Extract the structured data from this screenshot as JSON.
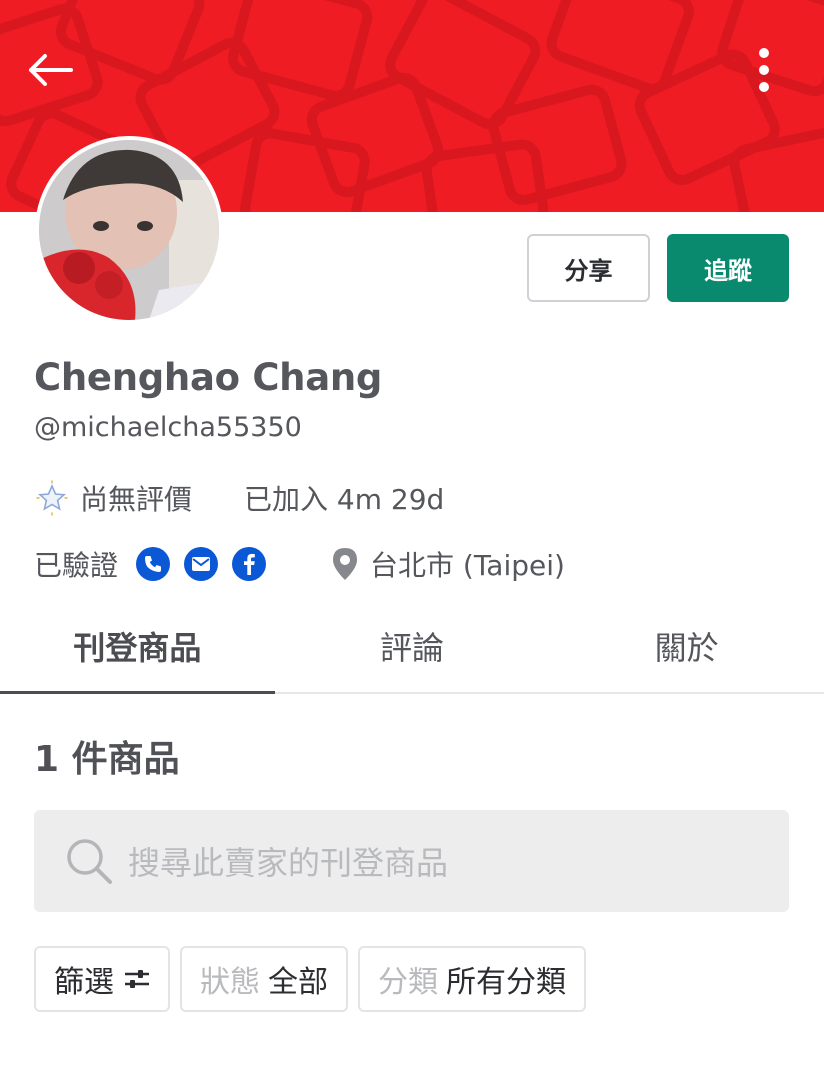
{
  "header": {
    "back_icon": "arrow-left-icon",
    "more_icon": "vertical-dots-icon",
    "banner_color": "#ef1c24"
  },
  "profile": {
    "name": "Chenghao Chang",
    "handle": "@michaelcha55350",
    "rating_text": "尚無評價",
    "joined_text": "已加入 4m 29d",
    "verified_label": "已驗證",
    "verified_icons": [
      "phone-icon",
      "email-icon",
      "facebook-icon"
    ],
    "location": "台北市 (Taipei)"
  },
  "actions": {
    "share_label": "分享",
    "follow_label": "追蹤",
    "follow_color": "#098a6e"
  },
  "tabs": [
    {
      "label": "刊登商品",
      "active": true
    },
    {
      "label": "評論",
      "active": false
    },
    {
      "label": "關於",
      "active": false
    }
  ],
  "listings": {
    "count_text": "1 件商品",
    "search_placeholder": "搜尋此賣家的刊登商品",
    "filters": {
      "filter_label": "篩選",
      "status_label": "狀態",
      "status_value": "全部",
      "category_label": "分類",
      "category_value": "所有分類"
    }
  }
}
